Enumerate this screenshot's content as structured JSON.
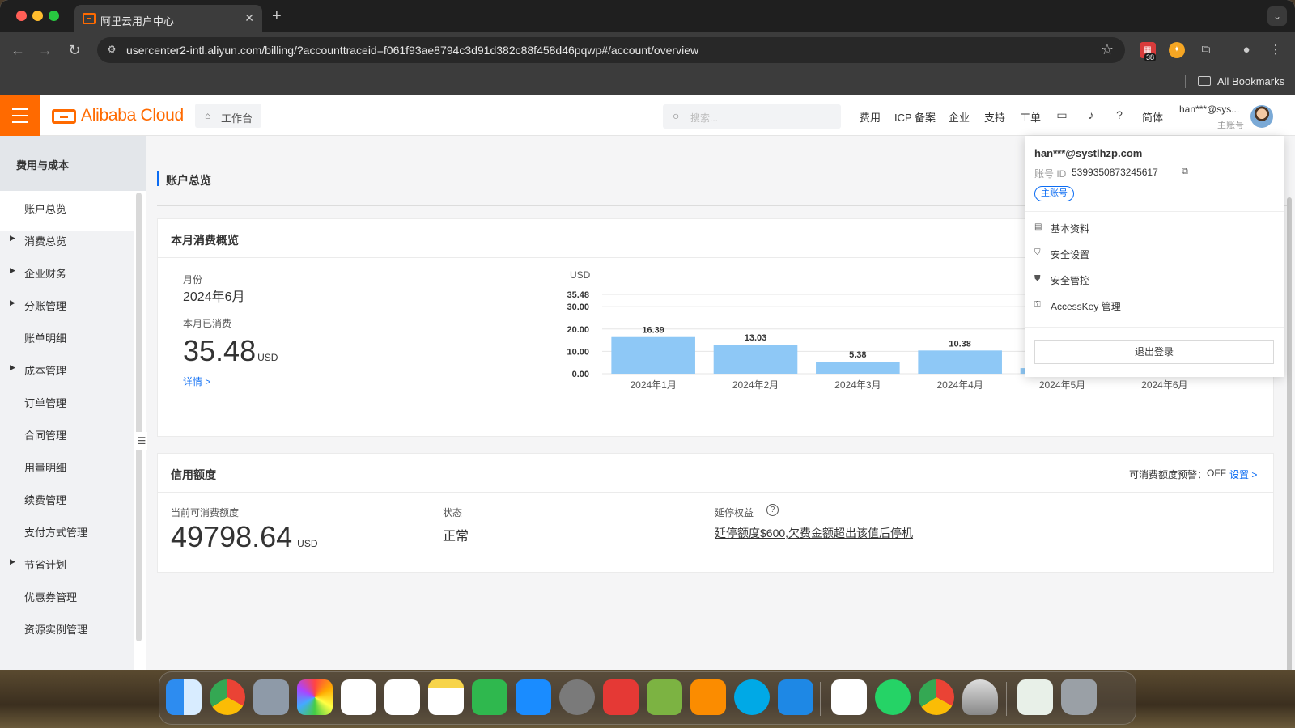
{
  "browser": {
    "tab_title": "阿里云用户中心",
    "url": "usercenter2-intl.aliyun.com/billing/?accounttraceid=f061f93ae8794c3d91d382c88f458d46pqwp#/account/overview",
    "bookmarks_label": "All Bookmarks",
    "ext_badge": "38"
  },
  "header": {
    "logo": "Alibaba Cloud",
    "workbench": "工作台",
    "search_placeholder": "搜索...",
    "nav": [
      "费用",
      "ICP 备案",
      "企业",
      "支持",
      "工单"
    ],
    "lang": "简体",
    "user_name": "han***@sys...",
    "user_role": "主账号"
  },
  "sidebar": {
    "title": "费用与成本",
    "items": [
      {
        "label": "账户总览",
        "expandable": false
      },
      {
        "label": "消费总览",
        "expandable": true
      },
      {
        "label": "企业财务",
        "expandable": true
      },
      {
        "label": "分账管理",
        "expandable": true
      },
      {
        "label": "账单明细",
        "expandable": false
      },
      {
        "label": "成本管理",
        "expandable": true
      },
      {
        "label": "订单管理",
        "expandable": false
      },
      {
        "label": "合同管理",
        "expandable": false
      },
      {
        "label": "用量明细",
        "expandable": false
      },
      {
        "label": "续费管理",
        "expandable": false
      },
      {
        "label": "支付方式管理",
        "expandable": false
      },
      {
        "label": "节省计划",
        "expandable": true
      },
      {
        "label": "优惠券管理",
        "expandable": false
      },
      {
        "label": "资源实例管理",
        "expandable": false
      }
    ]
  },
  "page": {
    "title": "账户总览"
  },
  "monthly": {
    "title": "本月消费概览",
    "month_label": "月份",
    "month_value": "2024年6月",
    "spent_label": "本月已消费",
    "spent_value": "35.48",
    "spent_unit": "USD",
    "details_link": "详情 >"
  },
  "chart_data": {
    "type": "bar",
    "unit_label": "USD",
    "categories": [
      "2024年1月",
      "2024年2月",
      "2024年3月",
      "2024年4月",
      "2024年5月",
      "2024年6月"
    ],
    "values": [
      16.39,
      13.03,
      5.38,
      10.38,
      2.5,
      3.0
    ],
    "data_labels": [
      "16.39",
      "13.03",
      "5.38",
      "10.38",
      "",
      ""
    ],
    "y_ticks": [
      "0.00",
      "10.00",
      "20.00",
      "30.00",
      "35.48"
    ],
    "y_tick_values": [
      0,
      10,
      20,
      30,
      35.48
    ],
    "ylim": [
      0,
      35.48
    ],
    "colors": {
      "bar": "#8ec8f6",
      "highlight": "#27c38a"
    },
    "highlight_index": 5
  },
  "credit": {
    "title": "信用额度",
    "alert_label": "可消费额度预警：",
    "alert_value": "OFF",
    "settings_link": "设置 >",
    "available_label": "当前可消费额度",
    "available_value": "49798.64",
    "available_unit": "USD",
    "status_label": "状态",
    "status_value": "正常",
    "extension_label": "延停权益",
    "extension_value": "延停额度$600,欠费金额超出该值后停机"
  },
  "account_menu": {
    "email": "han***@systlhzp.com",
    "id_label": "账号 ID",
    "id_value": "5399350873245617",
    "tag": "主账号",
    "items": [
      "基本资料",
      "安全设置",
      "安全管控",
      "AccessKey 管理"
    ],
    "logout": "退出登录"
  }
}
